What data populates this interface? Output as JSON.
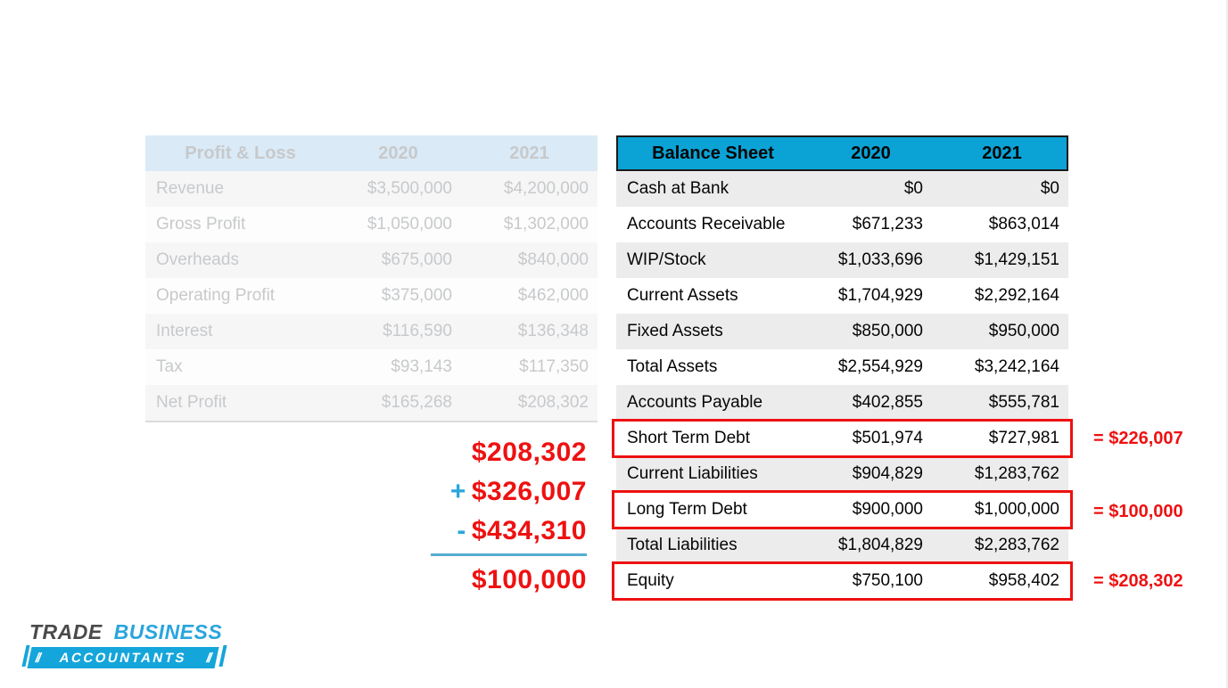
{
  "colors": {
    "accent_cyan": "#0ba3d6",
    "highlight_red": "#ee1111",
    "pnl_header_blue": "#daeaf6",
    "row_shade_gray": "#ececec"
  },
  "pnl_table": {
    "header": {
      "title": "Profit & Loss",
      "col_2020": "2020",
      "col_2021": "2021"
    },
    "rows": [
      {
        "label": "Revenue",
        "y2020": "$3,500,000",
        "y2021": "$4,200,000"
      },
      {
        "label": "Gross Profit",
        "y2020": "$1,050,000",
        "y2021": "$1,302,000"
      },
      {
        "label": "Overheads",
        "y2020": "$675,000",
        "y2021": "$840,000"
      },
      {
        "label": "Operating Profit",
        "y2020": "$375,000",
        "y2021": "$462,000"
      },
      {
        "label": "Interest",
        "y2020": "$116,590",
        "y2021": "$136,348"
      },
      {
        "label": "Tax",
        "y2020": "$93,143",
        "y2021": "$117,350"
      },
      {
        "label": "Net Profit",
        "y2020": "$165,268",
        "y2021": "$208,302"
      }
    ]
  },
  "balance_table": {
    "header": {
      "title": "Balance Sheet",
      "col_2020": "2020",
      "col_2021": "2021"
    },
    "rows": [
      {
        "label": "Cash at Bank",
        "y2020": "$0",
        "y2021": "$0",
        "highlighted": false
      },
      {
        "label": "Accounts Receivable",
        "y2020": "$671,233",
        "y2021": "$863,014",
        "highlighted": false
      },
      {
        "label": "WIP/Stock",
        "y2020": "$1,033,696",
        "y2021": "$1,429,151",
        "highlighted": false
      },
      {
        "label": "Current Assets",
        "y2020": "$1,704,929",
        "y2021": "$2,292,164",
        "highlighted": false
      },
      {
        "label": "Fixed Assets",
        "y2020": "$850,000",
        "y2021": "$950,000",
        "highlighted": false
      },
      {
        "label": "Total Assets",
        "y2020": "$2,554,929",
        "y2021": "$3,242,164",
        "highlighted": false
      },
      {
        "label": "Accounts Payable",
        "y2020": "$402,855",
        "y2021": "$555,781",
        "highlighted": false
      },
      {
        "label": "Short Term Debt",
        "y2020": "$501,974",
        "y2021": "$727,981",
        "highlighted": true
      },
      {
        "label": "Current Liabilities",
        "y2020": "$904,829",
        "y2021": "$1,283,762",
        "highlighted": false
      },
      {
        "label": "Long Term Debt",
        "y2020": "$900,000",
        "y2021": "$1,000,000",
        "highlighted": true
      },
      {
        "label": "Total Liabilities",
        "y2020": "$1,804,829",
        "y2021": "$2,283,762",
        "highlighted": false
      },
      {
        "label": "Equity",
        "y2020": "$750,100",
        "y2021": "$958,402",
        "highlighted": true
      }
    ]
  },
  "calculation": {
    "line1": "$208,302",
    "line2_op": "+",
    "line2_value": "$326,007",
    "line3_op": "-",
    "line3_value": "$434,310",
    "result": "$100,000"
  },
  "annotations": [
    {
      "text": "= $226,007"
    },
    {
      "text": "= $100,000"
    },
    {
      "text": "= $208,302"
    }
  ],
  "logo": {
    "trade": "TRADE",
    "business": "BUSINESS",
    "accountants": "ACCOUNTANTS",
    "slashes": "//"
  }
}
